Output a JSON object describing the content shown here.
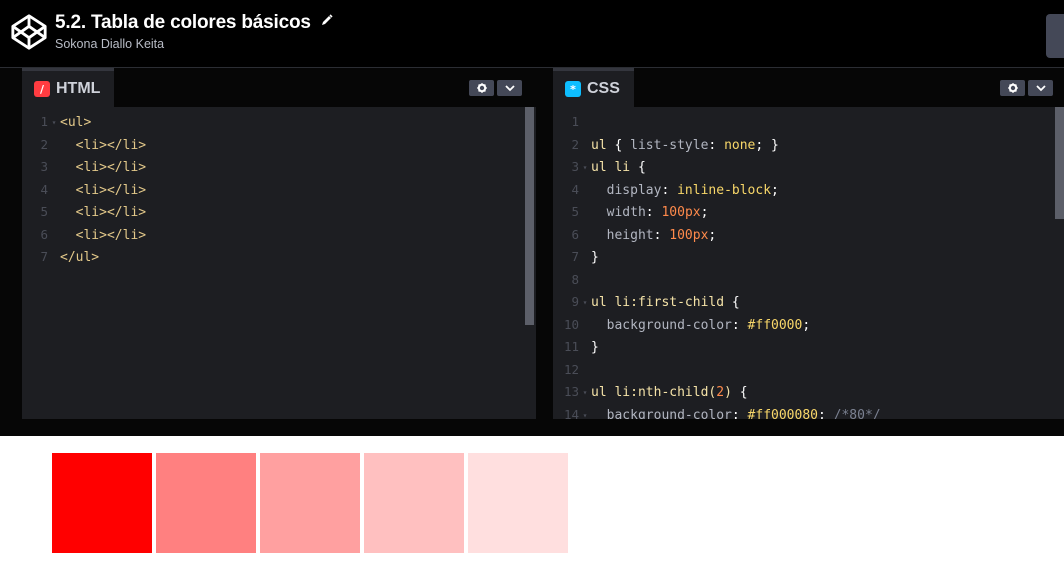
{
  "header": {
    "title": "5.2. Tabla de colores básicos",
    "author": "Sokona Diallo Keita"
  },
  "html_editor": {
    "tab_label": "HTML",
    "badge": "/",
    "badge_color": "#ff3c41",
    "lines": [
      {
        "n": "1",
        "fold": "▾",
        "code": "<ul>"
      },
      {
        "n": "2",
        "fold": "",
        "code": "  <li></li>"
      },
      {
        "n": "3",
        "fold": "",
        "code": "  <li></li>"
      },
      {
        "n": "4",
        "fold": "",
        "code": "  <li></li>"
      },
      {
        "n": "5",
        "fold": "",
        "code": "  <li></li>"
      },
      {
        "n": "6",
        "fold": "",
        "code": "  <li></li>"
      },
      {
        "n": "7",
        "fold": "",
        "code": "</ul>"
      }
    ]
  },
  "css_editor": {
    "tab_label": "CSS",
    "badge": "*",
    "badge_color": "#0ebeff",
    "lines": [
      {
        "n": "1",
        "fold": "",
        "code": ""
      },
      {
        "n": "2",
        "fold": "",
        "code": "ul { list-style: none; }"
      },
      {
        "n": "3",
        "fold": "▾",
        "code": "ul li {"
      },
      {
        "n": "4",
        "fold": "",
        "code": "  display: inline-block;"
      },
      {
        "n": "5",
        "fold": "",
        "code": "  width: 100px;"
      },
      {
        "n": "6",
        "fold": "",
        "code": "  height: 100px;"
      },
      {
        "n": "7",
        "fold": "",
        "code": "}"
      },
      {
        "n": "8",
        "fold": "",
        "code": ""
      },
      {
        "n": "9",
        "fold": "▾",
        "code": "ul li:first-child {"
      },
      {
        "n": "10",
        "fold": "",
        "code": "  background-color: #ff0000;"
      },
      {
        "n": "11",
        "fold": "",
        "code": "}"
      },
      {
        "n": "12",
        "fold": "",
        "code": ""
      },
      {
        "n": "13",
        "fold": "▾",
        "code": "ul li:nth-child(2) {"
      },
      {
        "n": "14",
        "fold": "▾",
        "code": "  background-color: #ff000080; /*80*/"
      }
    ]
  },
  "controls": {
    "settings_icon": "gear-icon",
    "collapse_icon": "chevron-down-icon"
  },
  "preview": {
    "swatches": [
      "#ff0000",
      "#ff8080",
      "#ffa0a0",
      "#ffc0c0",
      "#ffdfdf"
    ]
  }
}
